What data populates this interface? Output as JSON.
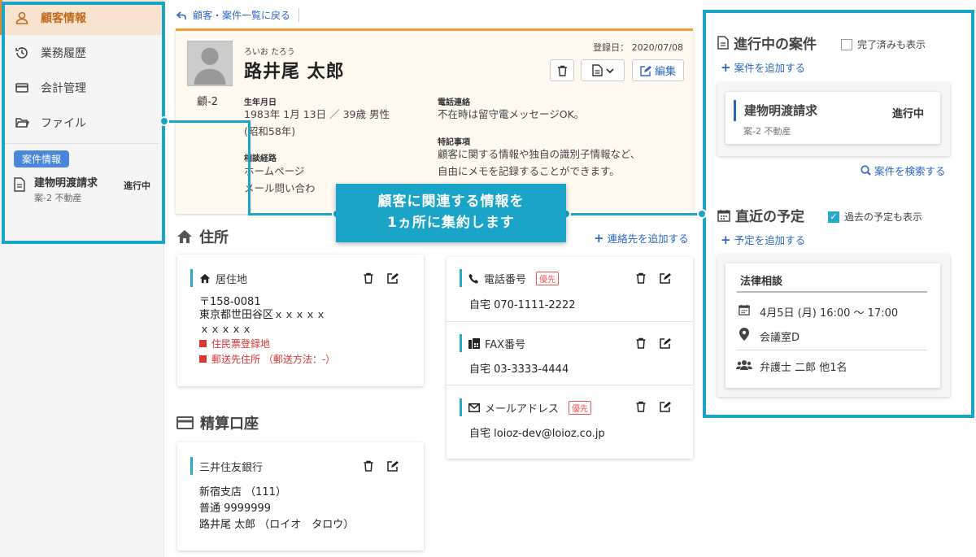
{
  "sidebar": {
    "items": [
      {
        "label": "顧客情報",
        "icon": "user-icon",
        "active": true
      },
      {
        "label": "業務履歴",
        "icon": "history-icon"
      },
      {
        "label": "会計管理",
        "icon": "card-icon"
      },
      {
        "label": "ファイル",
        "icon": "folder-icon"
      }
    ],
    "case_section_label": "案件情報",
    "case": {
      "title": "建物明渡請求",
      "sub": "案-2 不動産",
      "status": "進行中"
    }
  },
  "back_link": "顧客・案件一覧に戻る",
  "profile": {
    "id": "顧-2",
    "kana": "ろいお たろう",
    "name": "路井尾 太郎",
    "registered": "登録日： 2020/07/08",
    "edit_label": "編集",
    "birth_label": "生年月日",
    "birth_value": "1983年 1月 13日 ／ 39歳 男性",
    "birth_era": "(昭和58年)",
    "source_label": "相談経路",
    "source_value1": "ホームページ",
    "source_value2": "メール問い合わ",
    "phone_label": "電話連絡",
    "phone_value": "不在時は留守電メッセージOK。",
    "notes_label": "特記事項",
    "notes_value1": "顧客に関する情報や独自の識別子情報など、",
    "notes_value2": "自由にメモを記録することができます。"
  },
  "address": {
    "heading": "住所",
    "add_contact": "連絡先を追加する",
    "card_title": "居住地",
    "postal": "〒158-0081",
    "line1": "東京都世田谷区ｘｘｘｘｘ",
    "line2": "ｘｘｘｘｘ",
    "tag1": "住民票登録地",
    "tag2": "郵送先住所 （郵送方法：-）"
  },
  "bank": {
    "heading": "精算口座",
    "card_title": "三井住友銀行",
    "branch": "新宿支店 （111）",
    "account": "普通 9999999",
    "holder": "路井尾 太郎 （ロイオ　タロウ）"
  },
  "contacts": [
    {
      "title": "電話番号",
      "badge": "優先",
      "value": "自宅 070-1111-2222",
      "icon": "phone-icon"
    },
    {
      "title": "FAX番号",
      "badge": "",
      "value": "自宅 03-3333-4444",
      "icon": "fax-icon"
    },
    {
      "title": "メールアドレス",
      "badge": "優先",
      "value": "自宅 loioz-dev@loioz.co.jp",
      "icon": "mail-icon"
    }
  ],
  "callout": {
    "line1": "顧客に関連する情報を",
    "line2": "1ヵ所に集約します"
  },
  "cases": {
    "heading": "進行中の案件",
    "show_completed": "完了済みも表示",
    "add": "案件を追加する",
    "item_title": "建物明渡請求",
    "item_status": "進行中",
    "item_sub": "案-2 不動産",
    "search": "案件を検索する"
  },
  "schedule": {
    "heading": "直近の予定",
    "show_past": "過去の予定も表示",
    "show_past_checked": true,
    "add": "予定を追加する",
    "title": "法律相談",
    "datetime": "4月5日 (月) 16:00 〜 17:00",
    "place": "会議室D",
    "attendees": "弁護士 二郎 他1名"
  },
  "colors": {
    "accent": "#1aa5c8",
    "link": "#2b66c4",
    "active_bg": "#f9e3ce",
    "orange": "#f0a030"
  }
}
